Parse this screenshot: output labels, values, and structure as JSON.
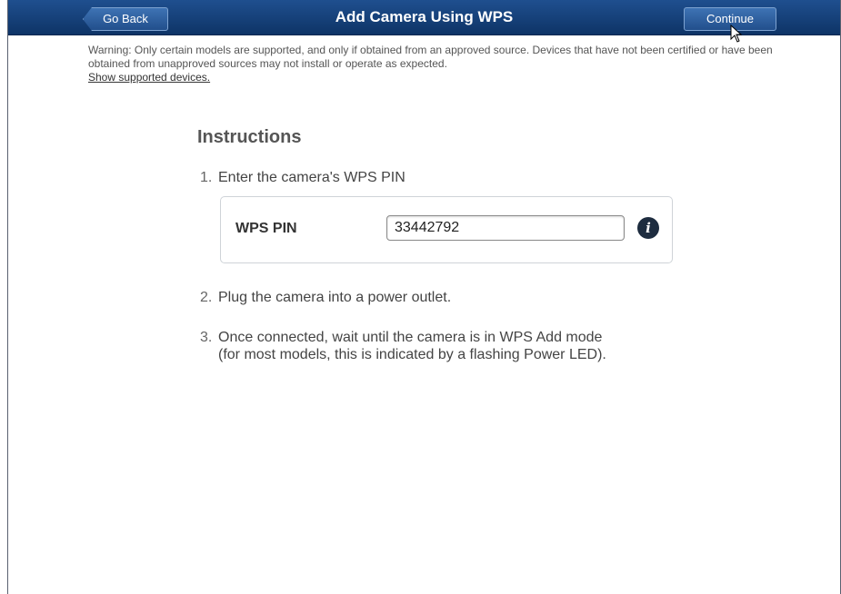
{
  "header": {
    "title": "Add Camera Using WPS",
    "back_label": "Go Back",
    "continue_label": "Continue"
  },
  "warning": {
    "text": "Warning: Only certain models are supported, and only if obtained from an approved source. Devices that have not been certified or have been obtained from unapproved sources may not install or operate as expected.",
    "link": "Show supported devices."
  },
  "instructions": {
    "title": "Instructions",
    "steps": [
      {
        "num": "1.",
        "text": "Enter the camera's WPS PIN"
      },
      {
        "num": "2.",
        "text": "Plug the camera into a power outlet."
      },
      {
        "num": "3.",
        "line1": "Once connected, wait until the camera is in WPS Add mode",
        "line2": "(for most models, this is indicated by a flashing Power LED)."
      }
    ]
  },
  "pin": {
    "label": "WPS PIN",
    "value": "33442792"
  },
  "icons": {
    "info": "info-icon",
    "info_glyph": "i",
    "cursor": "mouse-pointer-icon"
  },
  "colors": {
    "header_bg": "#0e3466",
    "button_bg": "#2a5a9a"
  }
}
